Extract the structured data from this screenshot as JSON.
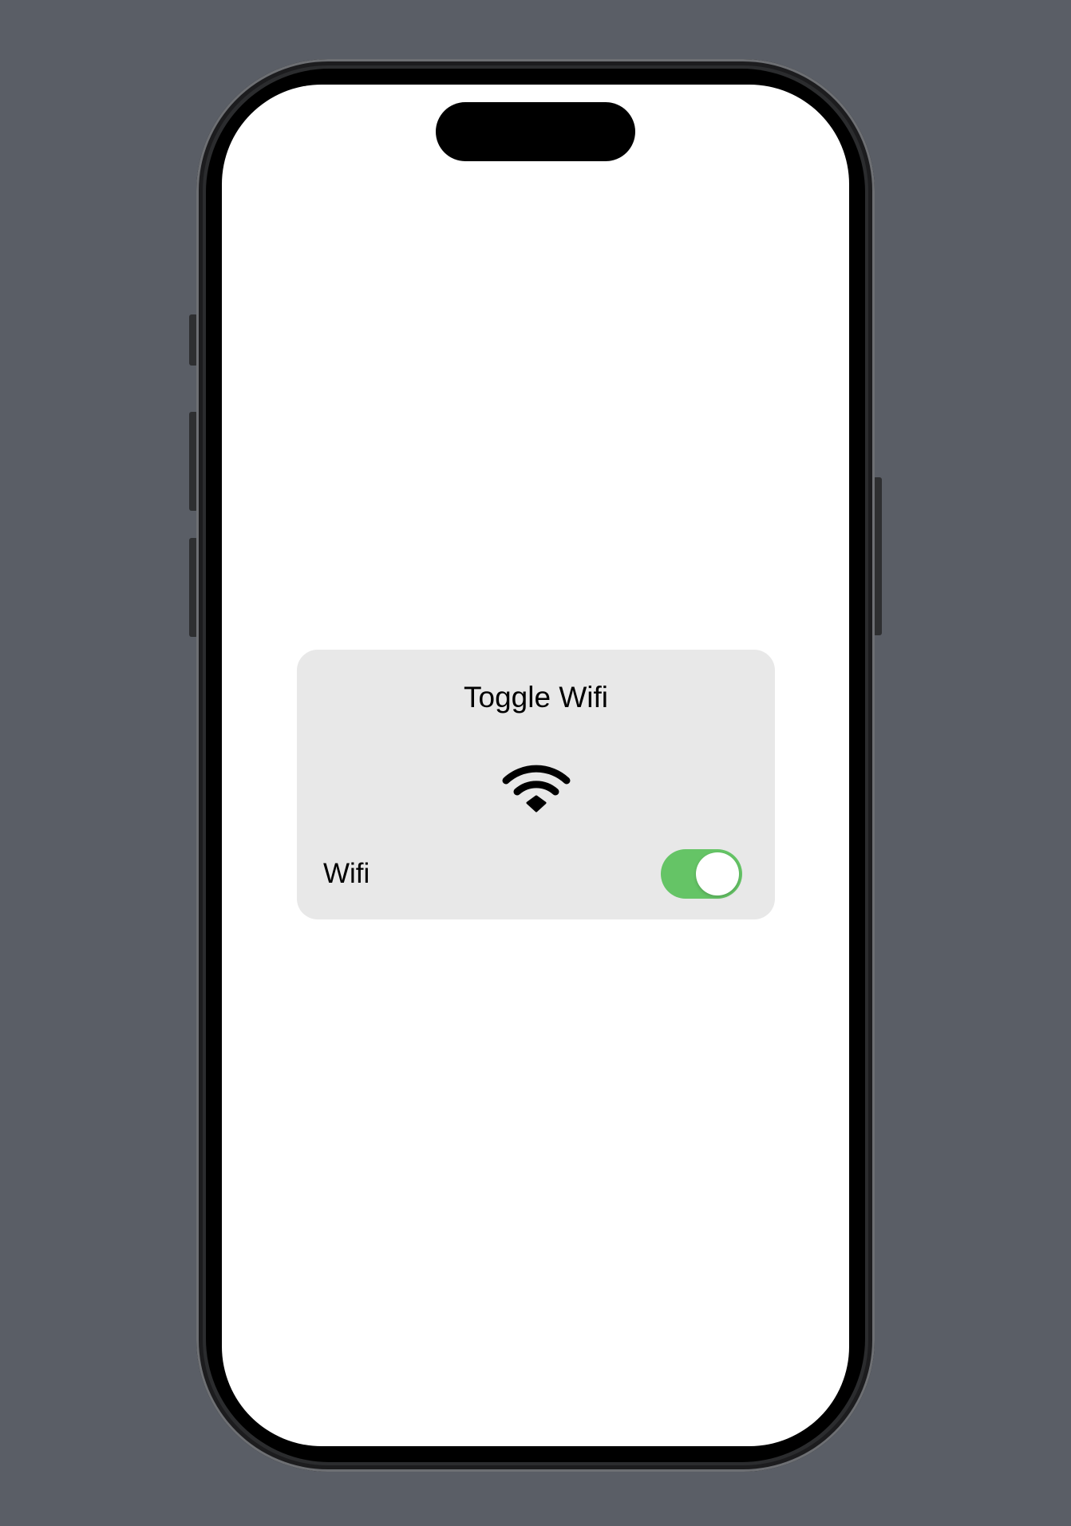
{
  "card": {
    "title": "Toggle Wifi",
    "icon": "wifi-icon",
    "row": {
      "label": "Wifi",
      "toggle_on": true
    }
  },
  "colors": {
    "background": "#5a5e66",
    "card": "#e8e8e8",
    "toggle_on": "#65c466"
  }
}
